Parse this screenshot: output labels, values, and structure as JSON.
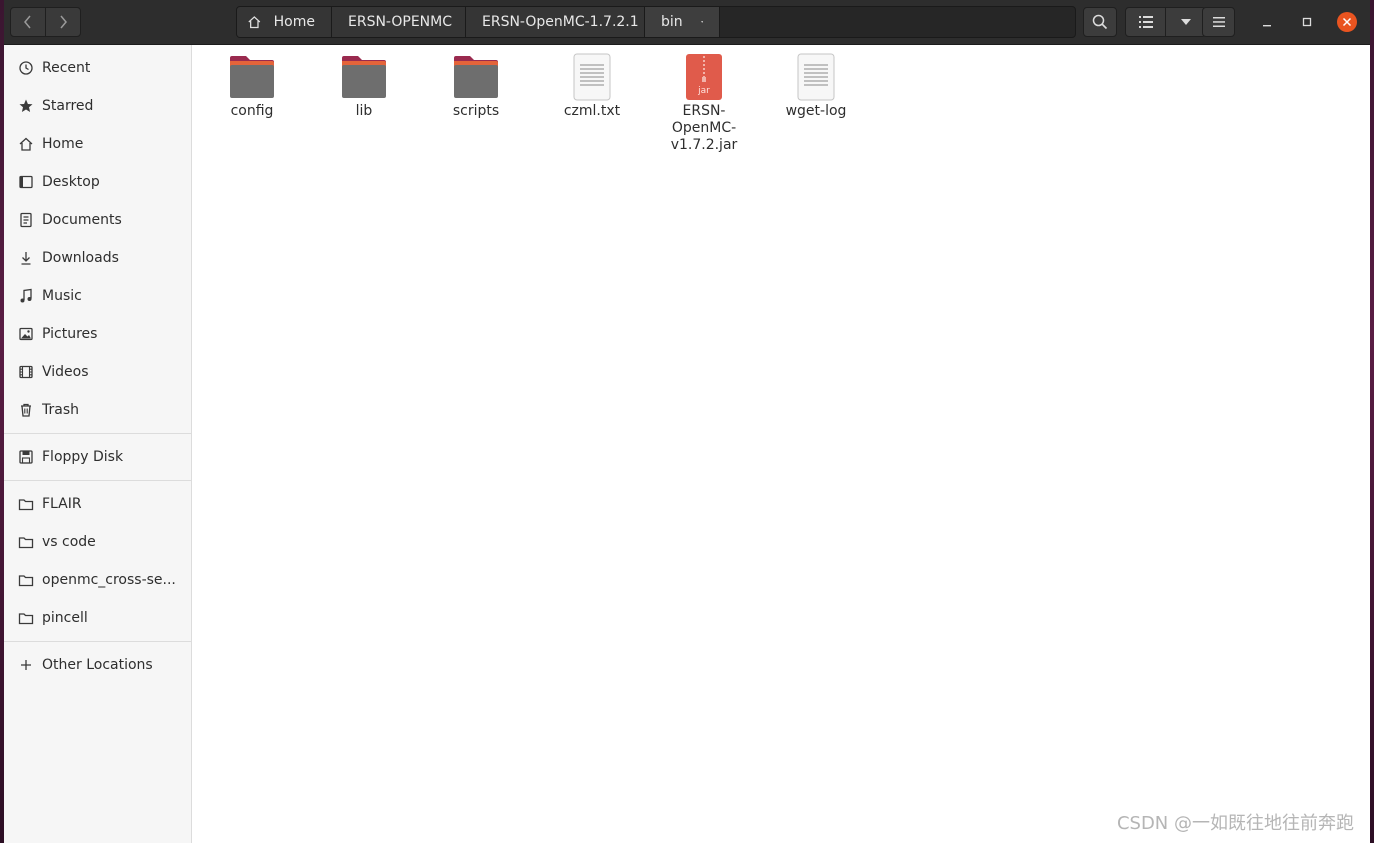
{
  "pathbar": {
    "crumbs": [
      "Home",
      "ERSN-OPENMC",
      "ERSN-OpenMC-1.7.2.1",
      "bin"
    ]
  },
  "sidebar": {
    "places": [
      "Recent",
      "Starred",
      "Home",
      "Desktop",
      "Documents",
      "Downloads",
      "Music",
      "Pictures",
      "Videos",
      "Trash"
    ],
    "devices": [
      "Floppy Disk"
    ],
    "bookmarks": [
      "FLAIR",
      "vs code",
      "openmc_cross-se...",
      "pincell"
    ],
    "other": "Other Locations"
  },
  "files": [
    {
      "name": "config",
      "type": "folder"
    },
    {
      "name": "lib",
      "type": "folder"
    },
    {
      "name": "scripts",
      "type": "folder"
    },
    {
      "name": "czml.txt",
      "type": "text"
    },
    {
      "name": "ERSN-OpenMC-v1.7.2.jar",
      "display": [
        "ERSN-",
        "OpenMC-",
        "v1.7.2.jar"
      ],
      "type": "jar",
      "badge": "jar"
    },
    {
      "name": "wget-log",
      "type": "text"
    }
  ],
  "watermark": "CSDN @一如既往地往前奔跑",
  "colors": {
    "accent": "#e95420",
    "folder_top": "#9a2a4f",
    "folder_body": "#6e6e6e",
    "jar": "#e05b4b"
  }
}
